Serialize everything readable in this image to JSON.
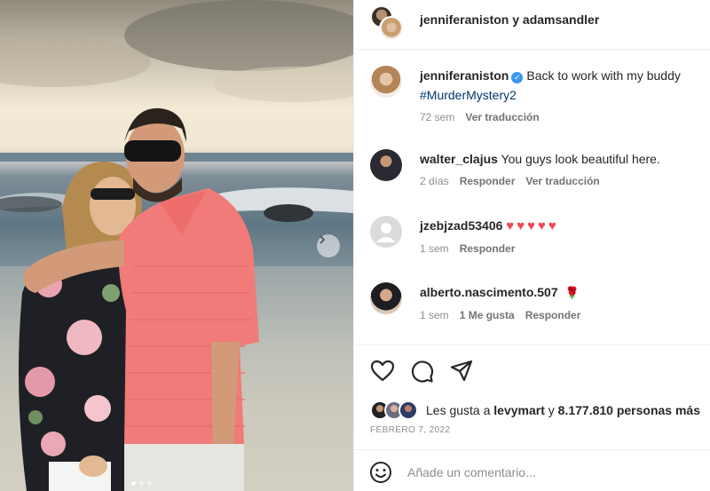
{
  "post": {
    "accounts_title": "jenniferaniston y adamsandler",
    "photo_alt": "",
    "carousel": {
      "count": 3,
      "active_index": 1
    }
  },
  "caption": {
    "username": "jenniferaniston",
    "verified": true,
    "text": "Back to work with my buddy",
    "hashtag": "#MurderMystery2",
    "time": "72 sem",
    "translate": "Ver traducción"
  },
  "comments": [
    {
      "username": "walter_clajus",
      "text": "You guys look beautiful here.",
      "time": "2 días",
      "reply": "Responder",
      "translate": "Ver traducción"
    },
    {
      "username": "jzebjzad53406",
      "text": "♥♥♥♥♥",
      "time": "1 sem",
      "reply": "Responder"
    },
    {
      "username": "alberto.nascimento.507",
      "text": "🌹",
      "time": "1 sem",
      "likes": "1 Me gusta",
      "reply": "Responder"
    }
  ],
  "actions": {
    "like_icon": "heart-icon",
    "comment_icon": "comment-icon",
    "share_icon": "paper-plane-icon"
  },
  "likes": {
    "prefix": "Les gusta a",
    "first_user": "levymart",
    "connector": "y",
    "count_text": "8.177.810 personas más"
  },
  "date": "FEBRERO 7, 2022",
  "add_comment": {
    "placeholder": "Añade un comentario..."
  },
  "colors": {
    "link": "#00376b",
    "verified": "#3897f0",
    "heart": "#ed4956",
    "muted": "#8e8e8e"
  }
}
